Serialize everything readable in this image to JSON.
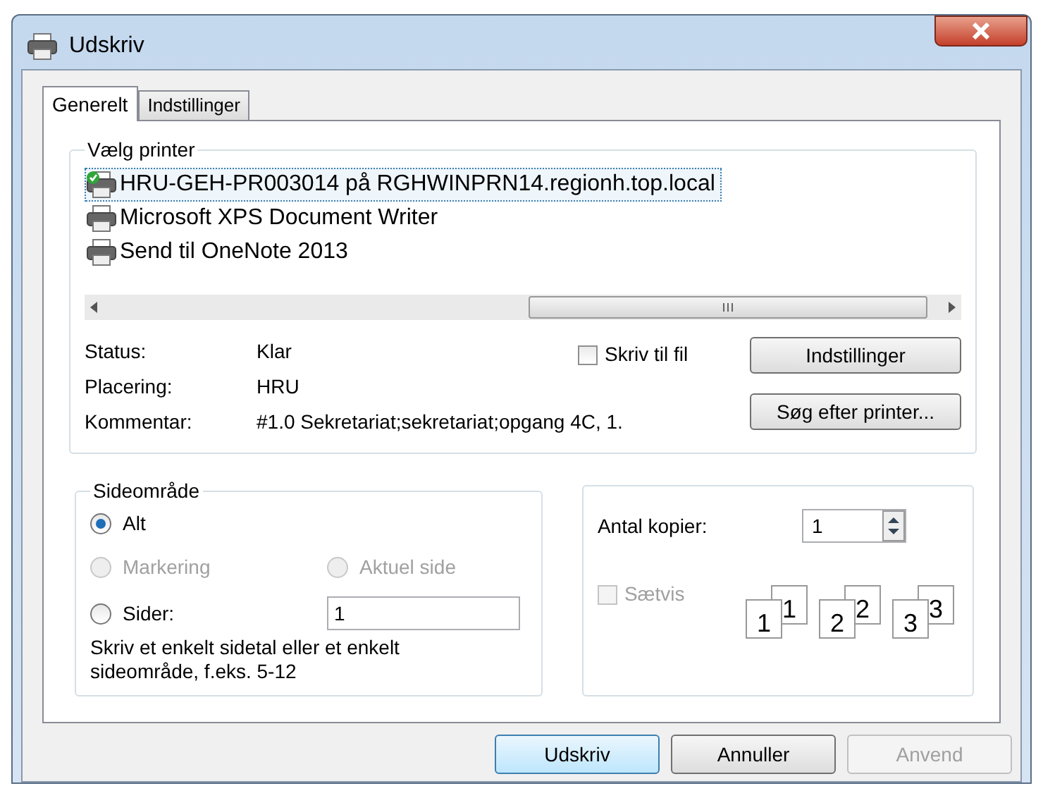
{
  "window": {
    "title": "Udskriv"
  },
  "tabs": [
    {
      "label": "Generelt",
      "selected": true
    },
    {
      "label": "Indstillinger",
      "selected": false
    }
  ],
  "printer_group": {
    "title": "Vælg printer",
    "printers": [
      {
        "name": "HRU-GEH-PR003014 på RGHWINPRN14.regionh.top.local",
        "selected": true,
        "is_default": true
      },
      {
        "name": "Microsoft XPS Document Writer",
        "selected": false,
        "is_default": false
      },
      {
        "name": "Send til OneNote 2013",
        "selected": false,
        "is_default": false
      }
    ],
    "info": [
      {
        "label": "Status:",
        "value": "Klar"
      },
      {
        "label": "Placering:",
        "value": "HRU"
      },
      {
        "label": "Kommentar:",
        "value": "#1.0 Sekretariat;sekretariat;opgang 4C, 1."
      }
    ],
    "print_to_file": {
      "label": "Skriv til fil",
      "checked": false
    },
    "buttons": [
      "Indstillinger",
      "Søg efter printer..."
    ]
  },
  "page_range": {
    "title": "Sideområde",
    "options": [
      {
        "label": "Alt",
        "selected": true,
        "disabled": false
      },
      {
        "label": "Markering",
        "selected": false,
        "disabled": true
      },
      {
        "label": "Aktuel side",
        "selected": false,
        "disabled": true
      },
      {
        "label": "Sider:",
        "selected": false,
        "disabled": false
      }
    ],
    "pages_value": "1",
    "hint": "Skriv et enkelt sidetal eller et enkelt sideområde, f.eks. 5-12"
  },
  "copies": {
    "label": "Antal kopier:",
    "value": "1",
    "collate": {
      "label": "Sætvis",
      "checked": false,
      "disabled": true
    },
    "collate_pages": [
      {
        "back": "1",
        "front": "1"
      },
      {
        "back": "2",
        "front": "2"
      },
      {
        "back": "3",
        "front": "3"
      }
    ]
  },
  "buttons": [
    {
      "label": "Udskriv",
      "kind": "default",
      "disabled": false
    },
    {
      "label": "Annuller",
      "kind": "normal",
      "disabled": false
    },
    {
      "label": "Anvend",
      "kind": "normal",
      "disabled": true
    }
  ]
}
